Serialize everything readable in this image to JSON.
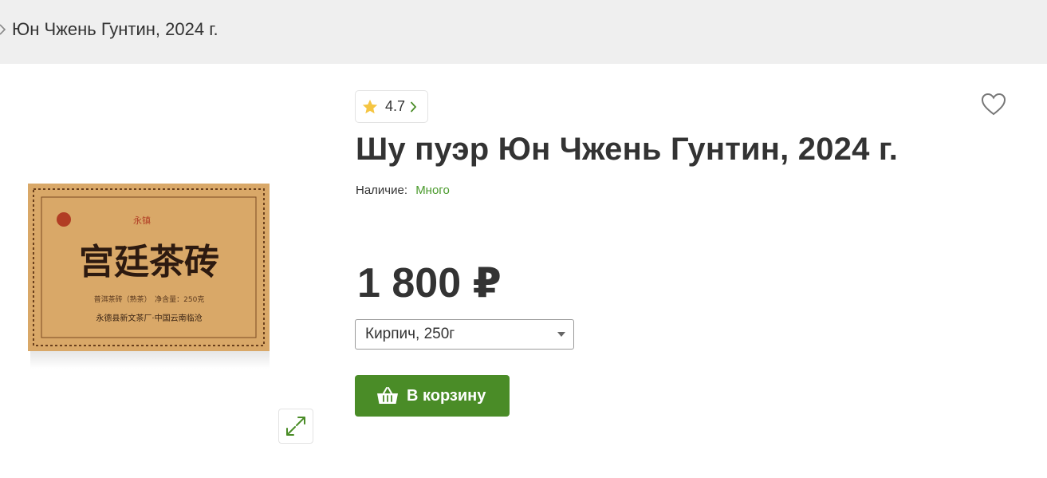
{
  "breadcrumb": {
    "current": "Юн Чжень Гунтин, 2024 г."
  },
  "product": {
    "title": "Шу пуэр Юн Чжень Гунтин, 2024 г.",
    "rating": "4.7",
    "availability_label": "Наличие:",
    "availability_value": "Много",
    "price": "1 800 ₽",
    "variant_selected": "Кирпич, 250г",
    "add_to_cart_label": "В корзину",
    "image": {
      "main_text": "宫廷茶砖",
      "brand_text": "永镇",
      "sub_text_1": "普洱茶砖（熟茶）　净含量：250克",
      "sub_text_2": "永德县新文茶厂·中国云南临沧"
    }
  },
  "colors": {
    "accent_green": "#4a8c27",
    "availability_green": "#4a9a2c",
    "star": "#f5c542",
    "topbar_bg": "#efefef"
  },
  "icons": [
    "chevron-right-icon",
    "star-icon",
    "heart-icon",
    "basket-icon",
    "expand-icon"
  ]
}
